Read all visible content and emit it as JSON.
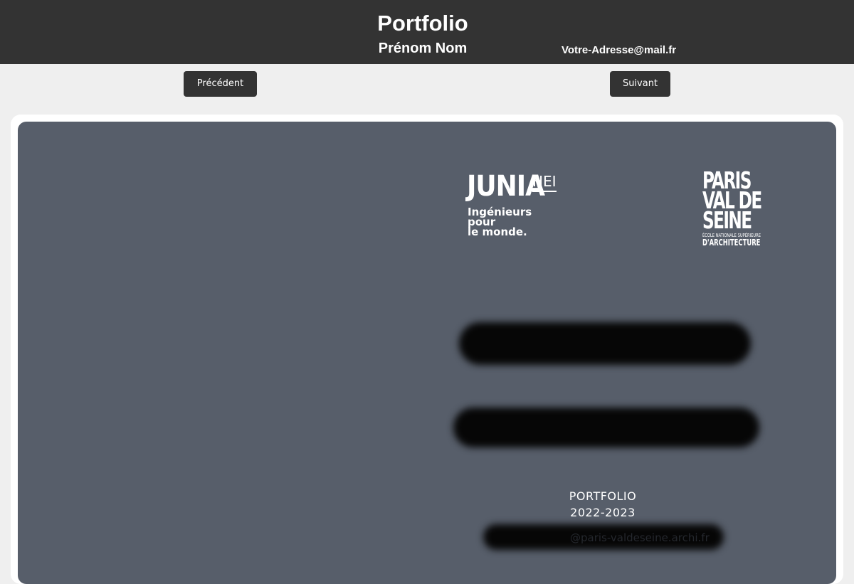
{
  "header": {
    "title": "Portfolio",
    "author": "Prénom Nom",
    "email": "Votre-Adresse@mail.fr",
    "background": "#333333"
  },
  "nav": {
    "prev_label": "Précédent",
    "next_label": "Suivant"
  },
  "document": {
    "background": "#575e6a",
    "junia_logo": {
      "name": "JUNIA",
      "school": "HEI",
      "tagline": [
        "Ingénieurs",
        "pour",
        "le monde."
      ]
    },
    "pvds_logo": {
      "lines": [
        "PARIS",
        "VAL DE",
        "SEINE"
      ],
      "subtitle": "ÉCOLE NATIONALE SUPÉRIEURE",
      "subtitle2": "D'ARCHITECTURE"
    },
    "portfolio_title": "PORTFOLIO",
    "year": "2022-2023",
    "contact_email": "@paris-valdeseine.archi.fr"
  }
}
